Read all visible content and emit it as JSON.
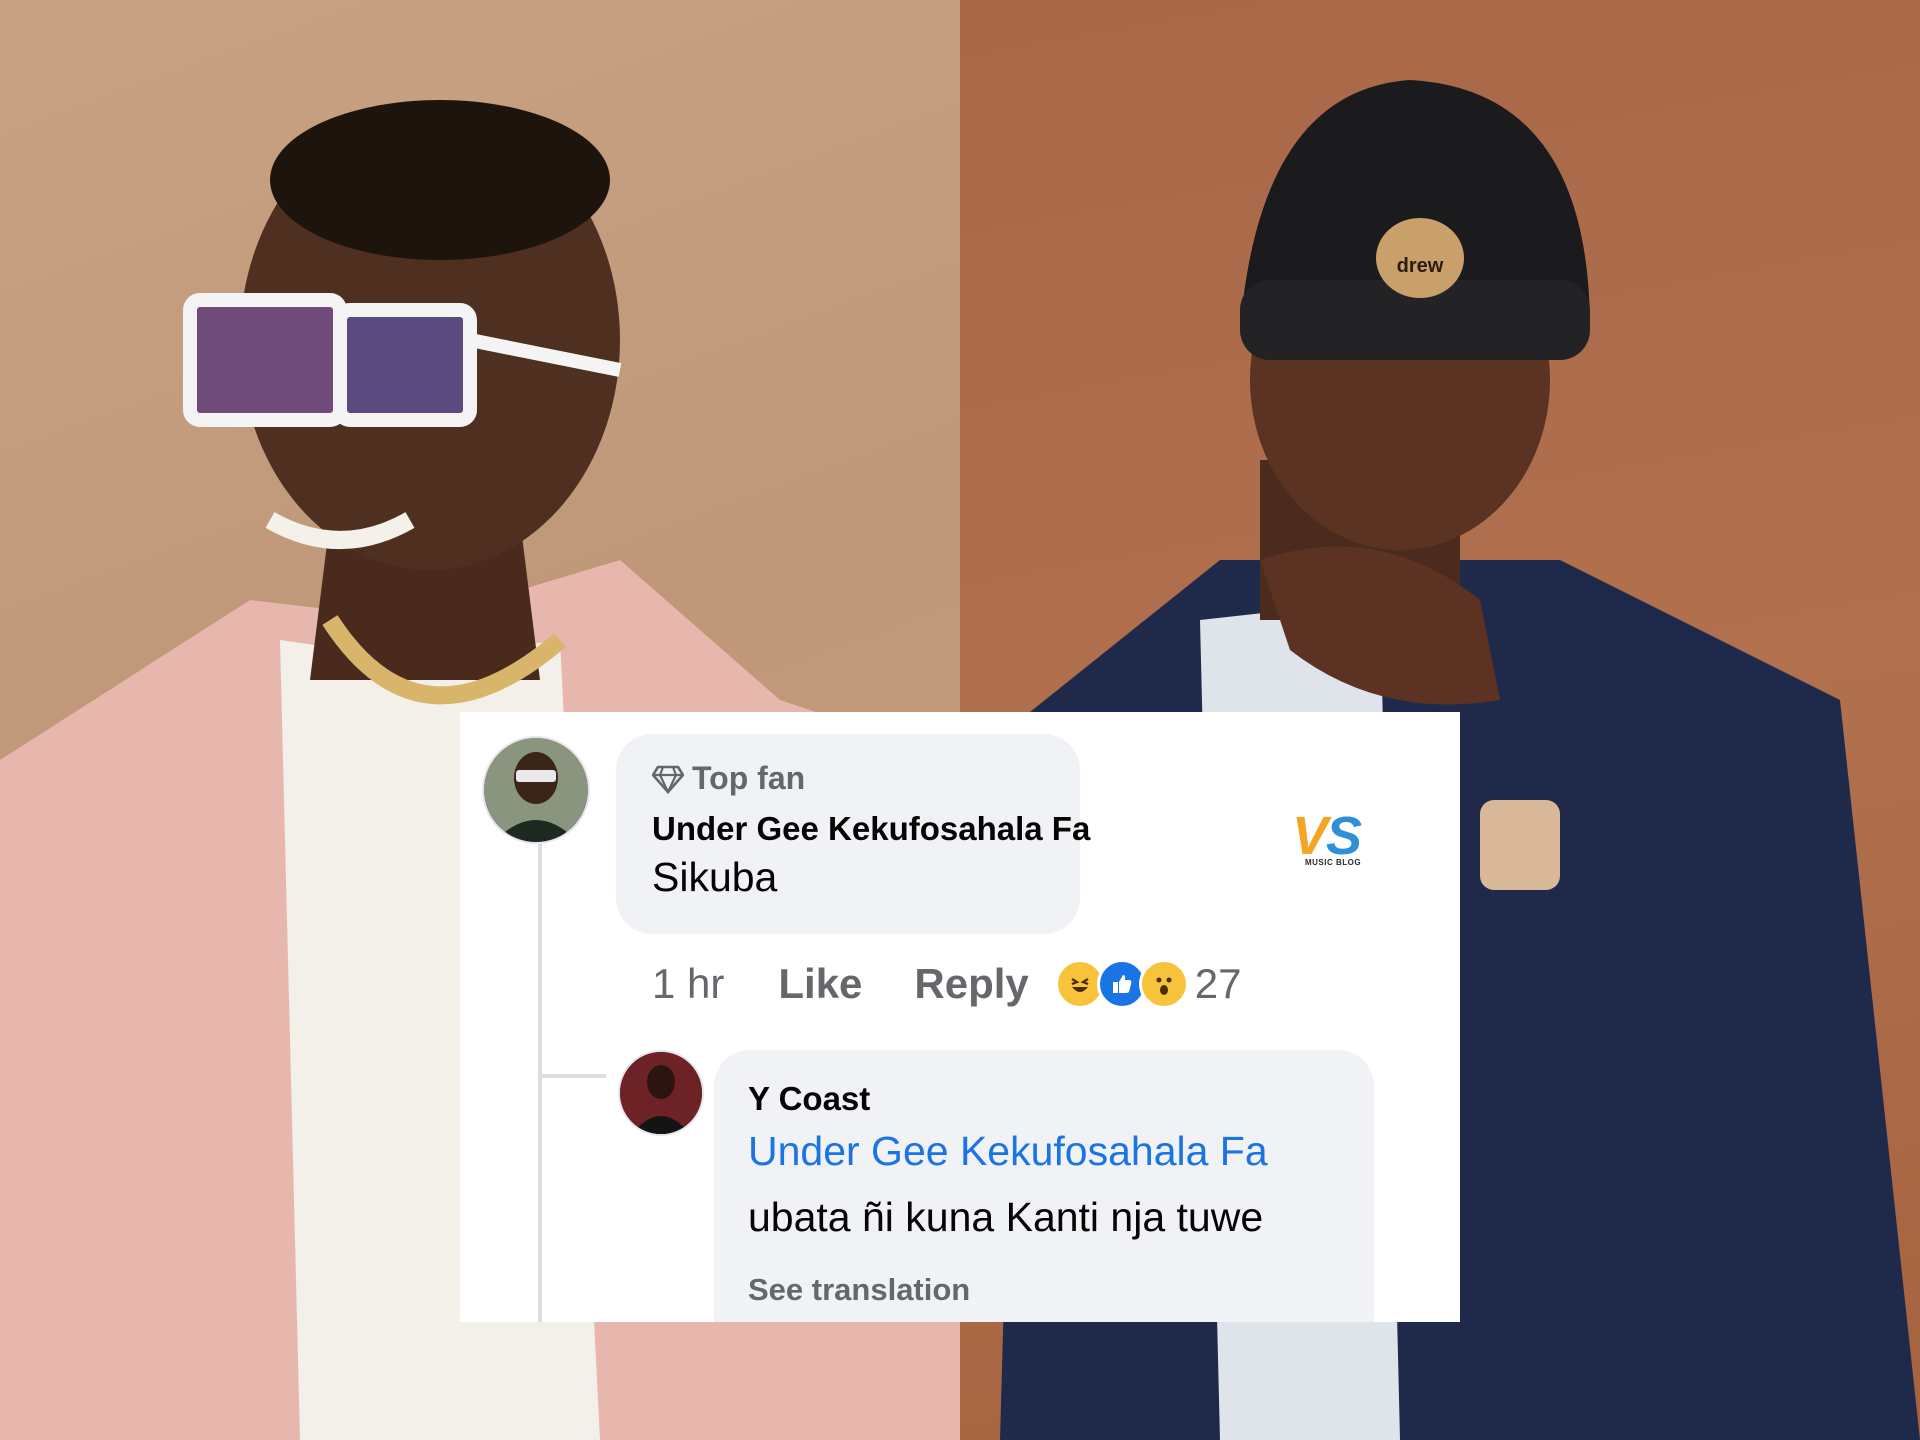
{
  "photo": {
    "left_description": "",
    "hat_text": "drew"
  },
  "comment": {
    "badge": "Top fan",
    "author": "Under Gee Kekufosahala Fa",
    "text": "Sikuba",
    "time": "1 hr",
    "like_label": "Like",
    "reply_label": "Reply",
    "reaction_count": "27",
    "reactions": [
      "haha-icon",
      "like-icon",
      "wow-icon"
    ]
  },
  "reply": {
    "author": "Y Coast",
    "mention": "Under Gee Kekufosahala Fa",
    "text": "ubata ñi kuna Kanti nja tuwe",
    "see_translation": "See translation"
  },
  "watermark": {
    "logo_text": "VS",
    "tagline": "MUSIC BLOG"
  },
  "colors": {
    "link": "#1b74e4",
    "bubble": "#f0f2f5",
    "secondary_text": "#65676b"
  }
}
